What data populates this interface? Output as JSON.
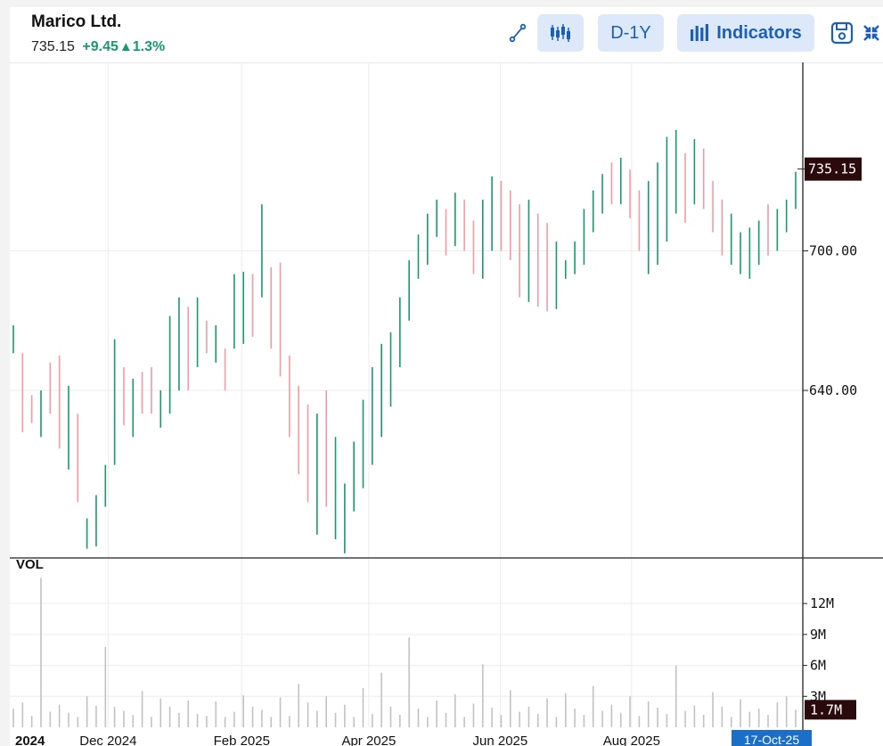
{
  "header": {
    "title": "Marico Ltd.",
    "price": "735.15",
    "change": "+9.45",
    "change_arrow": "▲",
    "change_pct": "1.3%"
  },
  "toolbar": {
    "draw_icon": "line-draw-icon",
    "candles_icon": "candlestick-icon",
    "range_label": "D-1Y",
    "indicators_icon": "bar-chart-icon",
    "indicators_label": "Indicators",
    "save_icon": "save-icon",
    "collapse_icon": "collapse-icon"
  },
  "colors": {
    "up": "#1a9a6c",
    "down": "#f29ba3",
    "accent": "#1b5fb8",
    "accent_bg": "#dde9f8",
    "last_badge": "#2a0a0a",
    "date_badge": "#1b6fc8"
  },
  "chart_data": [
    {
      "type": "candlestick",
      "title": "Marico Ltd.",
      "y_ticks": [
        "700.00",
        "640.00"
      ],
      "last_value_label": "735.15",
      "ylim": [
        568,
        781
      ],
      "x_tick_labels": [
        "2024",
        "Dec 2024",
        "Feb 2025",
        "Apr 2025",
        "Jun 2025",
        "Aug 2025"
      ],
      "x_tick_dates": [
        "2024-10-01",
        "2024-12-01",
        "2025-02-01",
        "2025-04-01",
        "2025-06-01",
        "2025-08-01"
      ],
      "x_range_dates": [
        "2024-10-18",
        "2025-10-17"
      ],
      "current_date_label": "17-Oct-25",
      "grid": true,
      "bar_highs": [
        668,
        656,
        638,
        640,
        652,
        655,
        642,
        630,
        585,
        595,
        608,
        662,
        650,
        645,
        648,
        650,
        640,
        672,
        680,
        676,
        680,
        670,
        668,
        658,
        690,
        691,
        690,
        720,
        693,
        695,
        655,
        642,
        634,
        630,
        640,
        620,
        600,
        618,
        636,
        650,
        660,
        665,
        680,
        696,
        707,
        716,
        722,
        718,
        725,
        722,
        713,
        722,
        732,
        730,
        726,
        720,
        722,
        716,
        712,
        704,
        696,
        704,
        718,
        726,
        733,
        738,
        740,
        735,
        726,
        730,
        738,
        749,
        752,
        742,
        748,
        744,
        730,
        722,
        716,
        708,
        710,
        713,
        720,
        718,
        722,
        734
      ],
      "bar_lows": [
        656,
        622,
        626,
        620,
        630,
        615,
        606,
        592,
        572,
        573,
        590,
        608,
        625,
        620,
        630,
        630,
        624,
        630,
        640,
        640,
        650,
        656,
        652,
        640,
        658,
        660,
        663,
        680,
        658,
        646,
        620,
        604,
        592,
        578,
        590,
        576,
        570,
        588,
        598,
        608,
        620,
        633,
        650,
        670,
        688,
        694,
        706,
        698,
        702,
        700,
        690,
        688,
        700,
        700,
        696,
        680,
        678,
        676,
        674,
        675,
        688,
        690,
        694,
        708,
        716,
        720,
        720,
        714,
        700,
        690,
        694,
        704,
        716,
        712,
        720,
        718,
        708,
        698,
        694,
        690,
        688,
        694,
        698,
        700,
        708,
        718
      ],
      "bar_dir": [
        "u",
        "d",
        "d",
        "u",
        "d",
        "d",
        "u",
        "d",
        "u",
        "u",
        "u",
        "u",
        "d",
        "u",
        "d",
        "d",
        "u",
        "u",
        "u",
        "d",
        "u",
        "d",
        "u",
        "d",
        "u",
        "u",
        "d",
        "u",
        "d",
        "d",
        "d",
        "d",
        "d",
        "u",
        "d",
        "u",
        "u",
        "u",
        "u",
        "u",
        "u",
        "u",
        "u",
        "u",
        "u",
        "u",
        "u",
        "d",
        "u",
        "d",
        "d",
        "u",
        "u",
        "d",
        "d",
        "d",
        "u",
        "d",
        "d",
        "u",
        "u",
        "u",
        "u",
        "u",
        "u",
        "d",
        "u",
        "d",
        "d",
        "u",
        "u",
        "u",
        "u",
        "d",
        "u",
        "d",
        "d",
        "d",
        "u",
        "u",
        "u",
        "u",
        "d",
        "u",
        "u",
        "u"
      ],
      "vol_label": "VOL",
      "vol_ticks": [
        "12M",
        "9M",
        "6M",
        "3M"
      ],
      "vol_ylim": [
        0,
        14
      ],
      "vol_last_label": "1.7M",
      "volumes": [
        1.8,
        2.4,
        1.1,
        14.5,
        1.5,
        2.2,
        1.4,
        1.0,
        3.0,
        2.1,
        7.8,
        2.0,
        1.6,
        1.2,
        3.5,
        1.0,
        2.8,
        2.0,
        1.4,
        2.6,
        1.3,
        1.1,
        2.5,
        1.0,
        1.5,
        3.1,
        2.0,
        1.7,
        1.0,
        2.9,
        1.1,
        4.2,
        2.4,
        1.6,
        3.0,
        1.4,
        2.2,
        1.0,
        3.8,
        1.3,
        5.3,
        2.0,
        1.2,
        8.7,
        1.8,
        1.0,
        2.6,
        1.4,
        3.2,
        1.0,
        2.3,
        6.1,
        1.9,
        1.2,
        3.6,
        1.5,
        2.0,
        1.3,
        2.8,
        1.0,
        3.3,
        1.8,
        1.2,
        4.0,
        1.6,
        2.2,
        1.4,
        3.0,
        1.1,
        2.5,
        1.9,
        1.3,
        6.0,
        1.6,
        2.1,
        1.2,
        3.4,
        2.0,
        1.0,
        2.7,
        1.5,
        1.8,
        1.2,
        2.4,
        3.0,
        1.7
      ]
    }
  ]
}
